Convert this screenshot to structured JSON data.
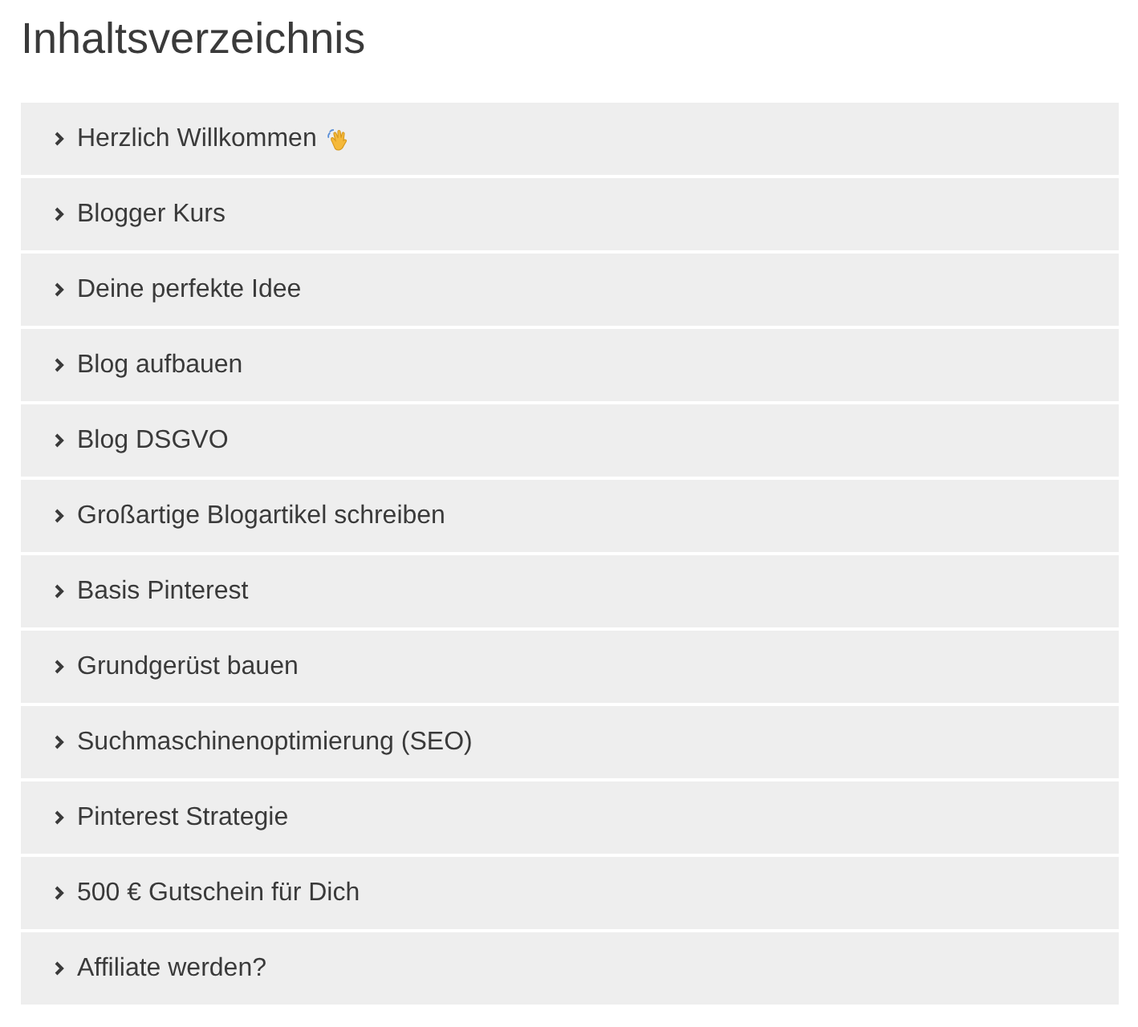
{
  "title": "Inhaltsverzeichnis",
  "sections": [
    {
      "label": "Herzlich Willkommen",
      "expanded": false,
      "trailing_icon": true
    },
    {
      "label": "Blogger Kurs",
      "expanded": false,
      "trailing_icon": false
    },
    {
      "label": "Deine perfekte Idee",
      "expanded": false,
      "trailing_icon": false
    },
    {
      "label": "Blog aufbauen",
      "expanded": false,
      "trailing_icon": false
    },
    {
      "label": "Blog DSGVO",
      "expanded": false,
      "trailing_icon": false
    },
    {
      "label": "Großartige Blogartikel schreiben",
      "expanded": false,
      "trailing_icon": false
    },
    {
      "label": "Basis Pinterest",
      "expanded": false,
      "trailing_icon": false
    },
    {
      "label": "Grundgerüst bauen",
      "expanded": false,
      "trailing_icon": false
    },
    {
      "label": "Suchmaschinenoptimierung (SEO)",
      "expanded": false,
      "trailing_icon": false
    },
    {
      "label": "Pinterest Strategie",
      "expanded": false,
      "trailing_icon": false
    },
    {
      "label": "500 € Gutschein für Dich",
      "expanded": false,
      "trailing_icon": false
    },
    {
      "label": "Affiliate werden?",
      "expanded": false,
      "trailing_icon": false
    }
  ]
}
